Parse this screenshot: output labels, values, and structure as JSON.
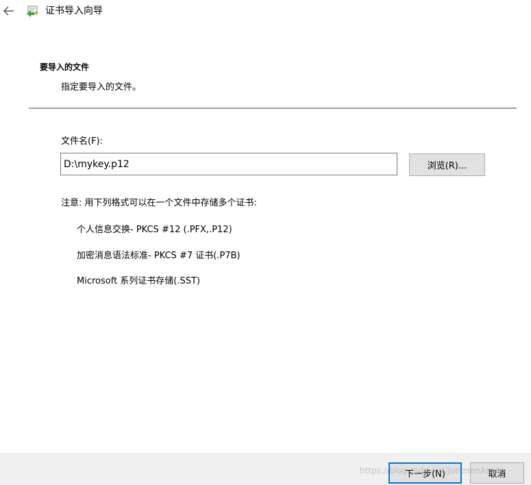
{
  "window": {
    "title": "证书导入向导",
    "back_icon": "back-arrow-icon",
    "app_icon": "certificate-icon"
  },
  "header": {
    "section_title": "要导入的文件",
    "section_subtitle": "指定要导入的文件。"
  },
  "form": {
    "file_label": "文件名(F):",
    "file_value": "D:\\mykey.p12",
    "browse_label": "浏览(R)..."
  },
  "note": {
    "text": "注意: 用下列格式可以在一个文件中存储多个证书:",
    "formats": [
      "个人信息交换- PKCS #12 (.PFX,.P12)",
      "加密消息语法标准- PKCS #7 证书(.P7B)",
      "Microsoft 系列证书存储(.SST)"
    ]
  },
  "footer": {
    "next_label": "下一步(N)",
    "cancel_label": "取消"
  },
  "watermark": "https://blog.csdn.net/JunesenAsen",
  "colors": {
    "accent": "#0078d7",
    "footer_bg": "#f0f0f0",
    "button_bg": "#e1e1e1"
  }
}
